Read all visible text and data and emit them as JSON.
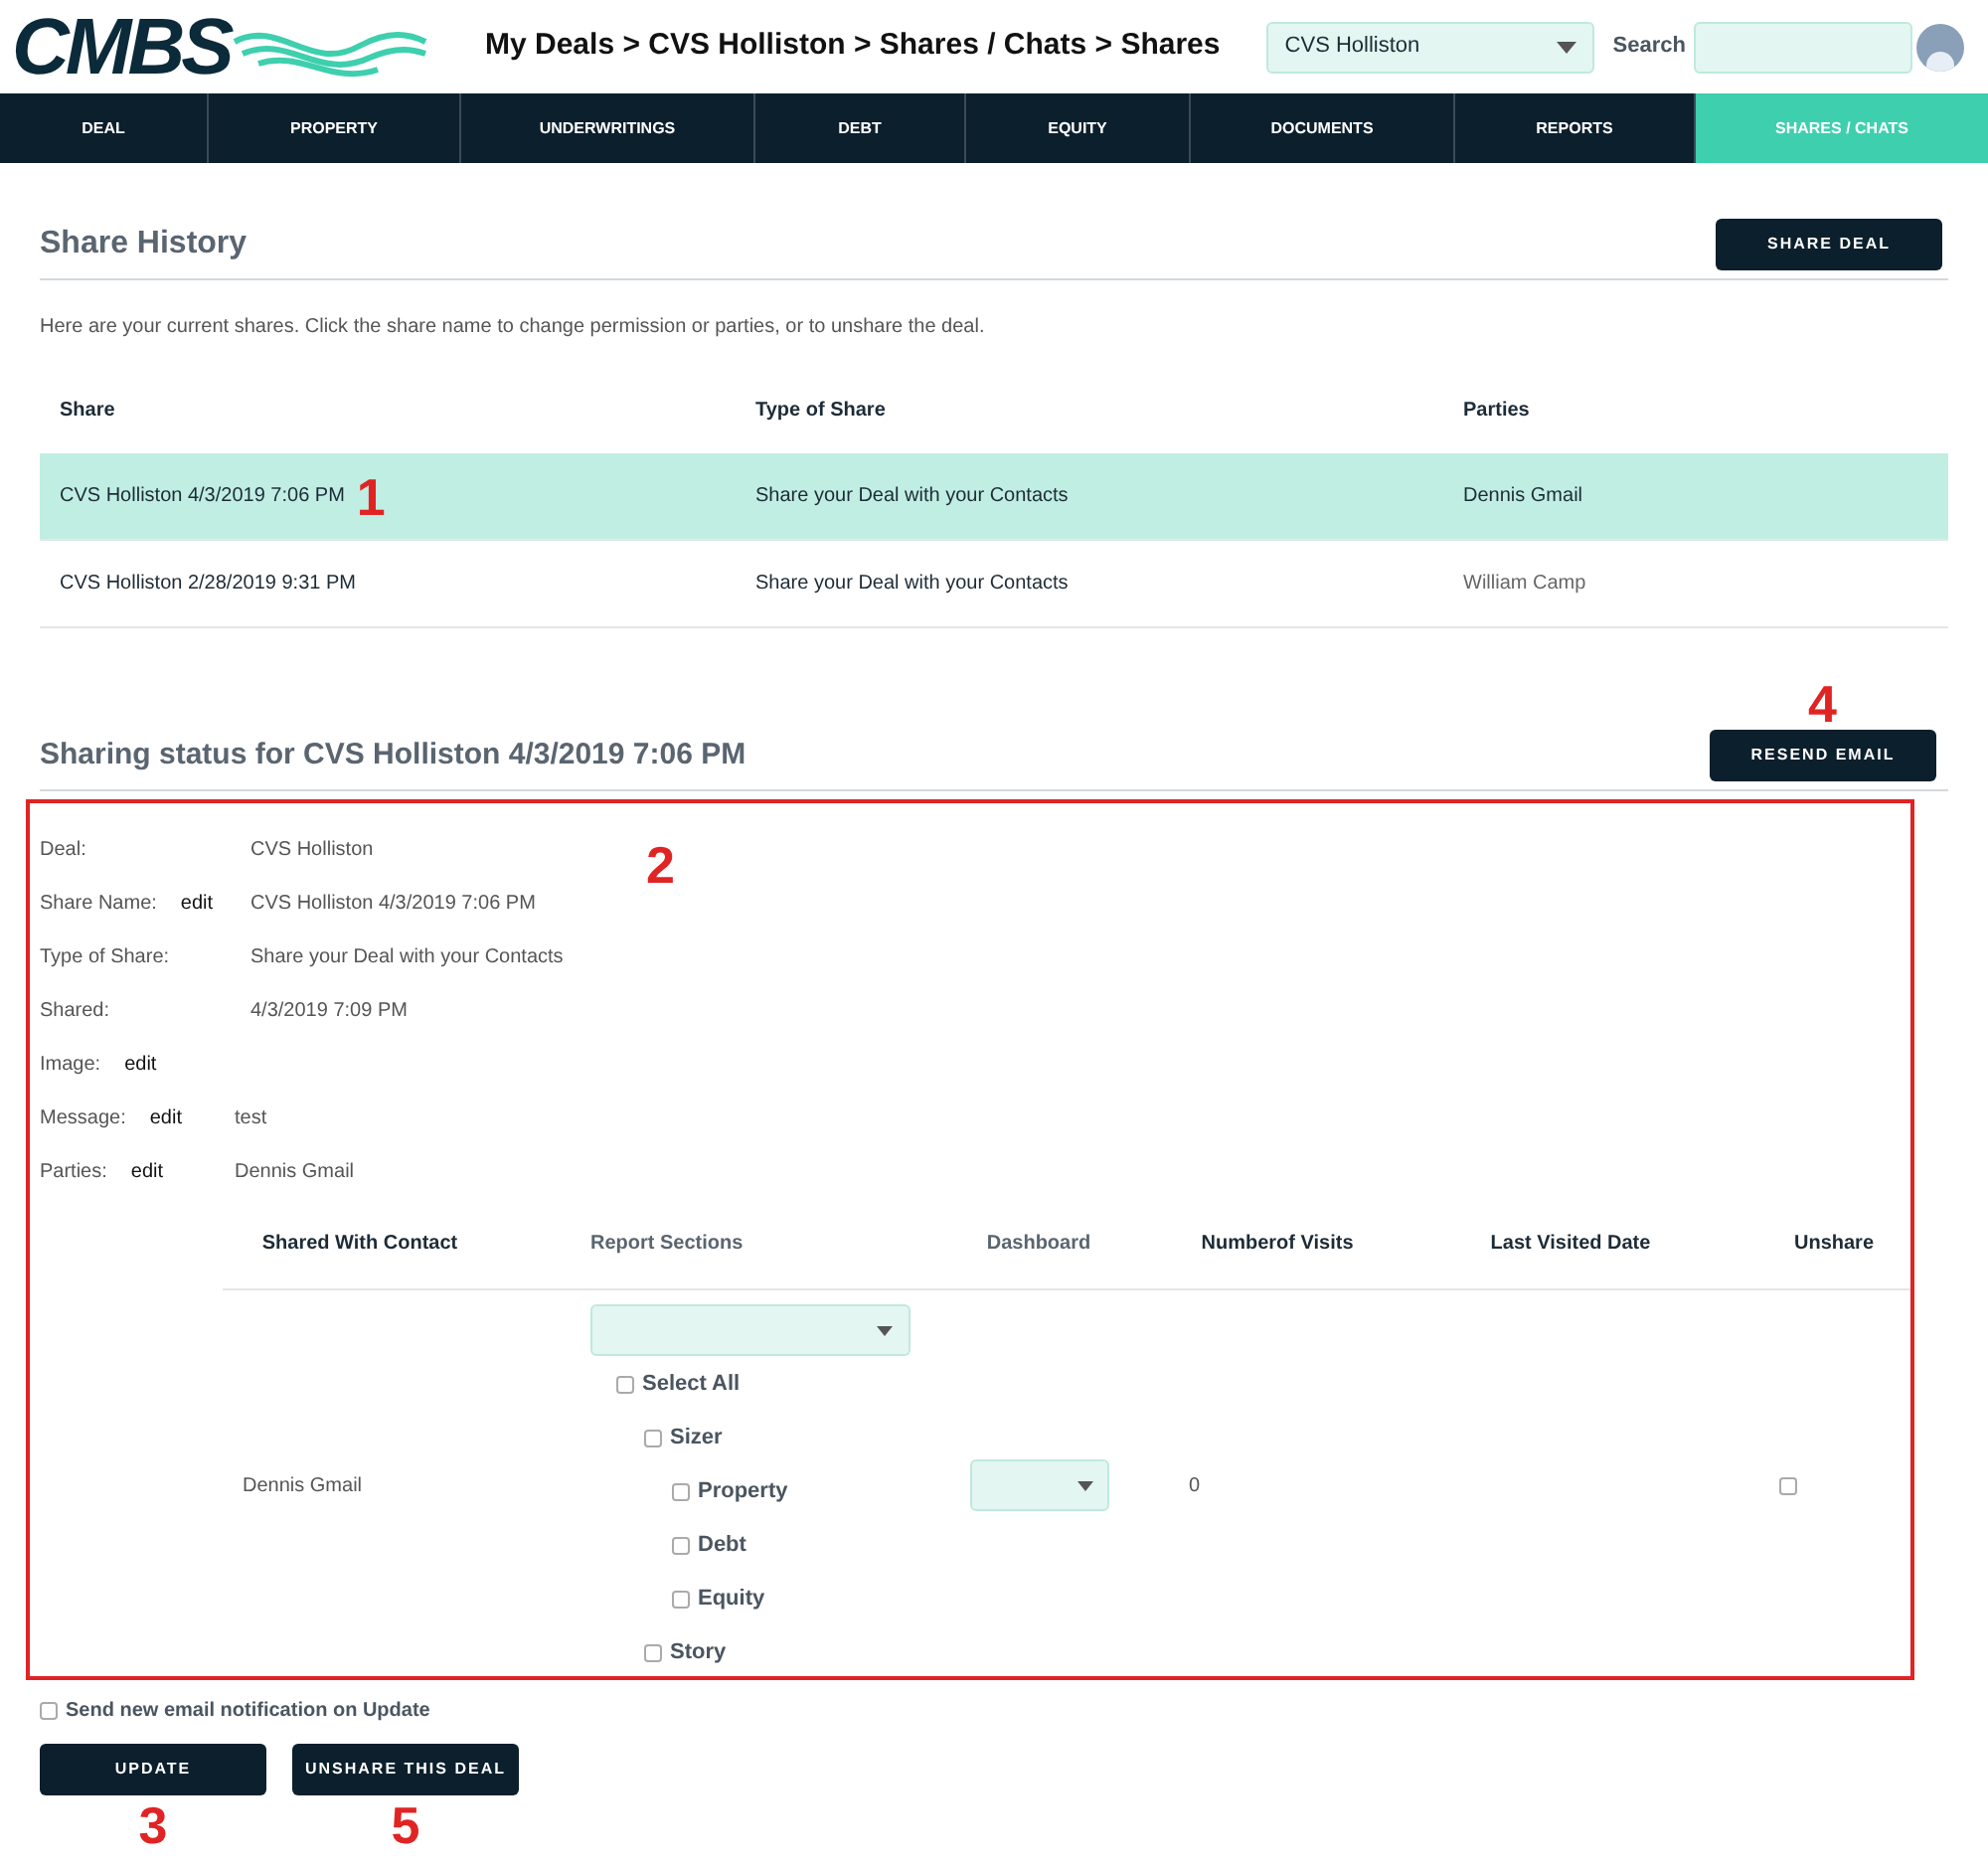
{
  "header": {
    "logo": "CMBS",
    "breadcrumb": "My Deals > CVS Holliston > Shares / Chats > Shares",
    "deal_select": "CVS Holliston",
    "search_label": "Search"
  },
  "nav": [
    {
      "label": "DEAL",
      "selected": false
    },
    {
      "label": "PROPERTY",
      "selected": false
    },
    {
      "label": "UNDERWRITINGS",
      "selected": false
    },
    {
      "label": "DEBT",
      "selected": false
    },
    {
      "label": "EQUITY",
      "selected": false
    },
    {
      "label": "DOCUMENTS",
      "selected": false
    },
    {
      "label": "REPORTS",
      "selected": false
    },
    {
      "label": "SHARES / CHATS",
      "selected": true
    }
  ],
  "share_history": {
    "title": "Share History",
    "button": "SHARE DEAL",
    "intro": "Here are your current shares. Click the share name to change permission or parties, or to unshare the deal.",
    "columns": [
      "Share",
      "Type of Share",
      "Parties"
    ],
    "rows": [
      {
        "cells": [
          "CVS Holliston 4/3/2019 7:06 PM",
          "Share your Deal with your Contacts",
          "Dennis Gmail"
        ],
        "selected": true
      },
      {
        "cells": [
          "CVS Holliston 2/28/2019 9:31 PM",
          "Share your Deal with your Contacts",
          "William Camp"
        ],
        "selected": false
      }
    ]
  },
  "sharing_status": {
    "title": "Sharing status for CVS Holliston 4/3/2019 7:06 PM",
    "button": "RESEND EMAIL",
    "details": [
      {
        "label": "Deal:",
        "value": "CVS Holliston"
      },
      {
        "label": "Share Name:",
        "edit": "edit",
        "value": "CVS Holliston 4/3/2019 7:06 PM"
      },
      {
        "label": "Type of Share:",
        "value": "Share your Deal with your Contacts"
      },
      {
        "label": "Shared:",
        "value": "4/3/2019 7:09 PM"
      },
      {
        "label": "Image:",
        "edit": "edit"
      },
      {
        "label": "Message:",
        "edit": "edit",
        "value": "test"
      },
      {
        "label": "Parties:",
        "edit": "edit",
        "value": "Dennis Gmail"
      }
    ],
    "columns": [
      "Shared With Contact",
      "Report Sections",
      "Dashboard",
      "Numberof Visits",
      "Last Visited Date",
      "Unshare"
    ],
    "contact": {
      "name": "Dennis Gmail",
      "visits": "0",
      "unshare_checked": false,
      "sections": [
        {
          "label": "Select All",
          "checked": false,
          "children": [
            {
              "label": "Sizer",
              "checked": false,
              "children": [
                {
                  "label": "Property",
                  "checked": false
                },
                {
                  "label": "Debt",
                  "checked": false
                },
                {
                  "label": "Equity",
                  "checked": false
                }
              ]
            },
            {
              "label": "Story",
              "checked": false
            }
          ]
        }
      ]
    }
  },
  "notify": {
    "label": "Send new email notification on Update",
    "checked": false
  },
  "actions": [
    "UPDATE",
    "UNSHARE THIS DEAL"
  ],
  "annotations": [
    "1",
    "2",
    "3",
    "4",
    "5"
  ]
}
